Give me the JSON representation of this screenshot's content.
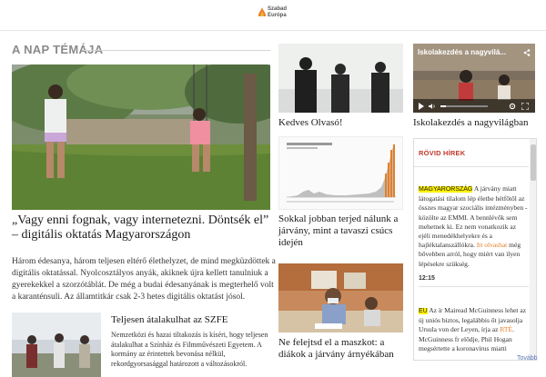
{
  "brand": {
    "logo_line1": "Szabad",
    "logo_line2": "Európa",
    "accent": "#e67e22"
  },
  "section": {
    "title": "A NAP TÉMÁJA"
  },
  "hero": {
    "title": "„Vagy enni fognak, vagy internetezni. Döntsék el” – digitális oktatás Magyarországon",
    "text": "Három édesanya, három teljesen eltérő élethelyzet, de mind megküzdöttek a digitális oktatással. Nyolcosztályos anyák, akiknek újra kellett tanulniuk a gyerekekkel a szorzótáblát. De még a budai édesanyának is megterhelő volt a karanténsuli. Az államtitkár csak 2-3 hetes digitális oktatást jósol."
  },
  "secondary": {
    "title": "Teljesen átalakulhat az SZFE",
    "text": "Nemzetközi és hazai tiltakozás is kíséri, hogy teljesen átalakulhat a Színház és Filmművészeti Egyetem. A kormány az érintettek bevonása nélkül, rekordgyorsasággal határozott a változásokról."
  },
  "column2": [
    {
      "title": "Kedves Olvasó!"
    },
    {
      "title": "Sokkal jobban terjed nálunk a járvány, mint a tavaszi csúcs idején"
    },
    {
      "title": "Ne felejtsd el a maszkot: a diákok a járvány árnyékában"
    }
  ],
  "video": {
    "title": "Iskolakezdés a nagyvilá...",
    "caption": "Iskolakezdés a nagyvilágban"
  },
  "news": {
    "header": "RÖVID HÍREK",
    "item1_tag": "MAGYARORSZÁG",
    "item1_text_a": " A járvány miatt látogatási tilalom lép életbe hétfőtől az összes magyar szociális intézményben - közölte az EMMI. A bennlévők sem mehetnek ki. Ez nem vonatkozik az ejéli menedékhelyekre és a hajléktalanszállókra.",
    "item1_link": "Itt olvashat",
    "item1_text_b": " még bővebben arról, hogy miért van ilyen lépésekre szükség.",
    "time": "12:15",
    "item2_tag": "EU",
    "item2_text_a": " Az ír Mairead McGuinness lehet az új uniós biztos, legalábbis őt javasolja Ursula von der Leyen, írja az",
    "item2_link": "RTÉ",
    "item2_text_b": ". McGuinness fr elődje, Phil Hogan megsértette a koronavírus miatti",
    "more": "Tovább"
  }
}
